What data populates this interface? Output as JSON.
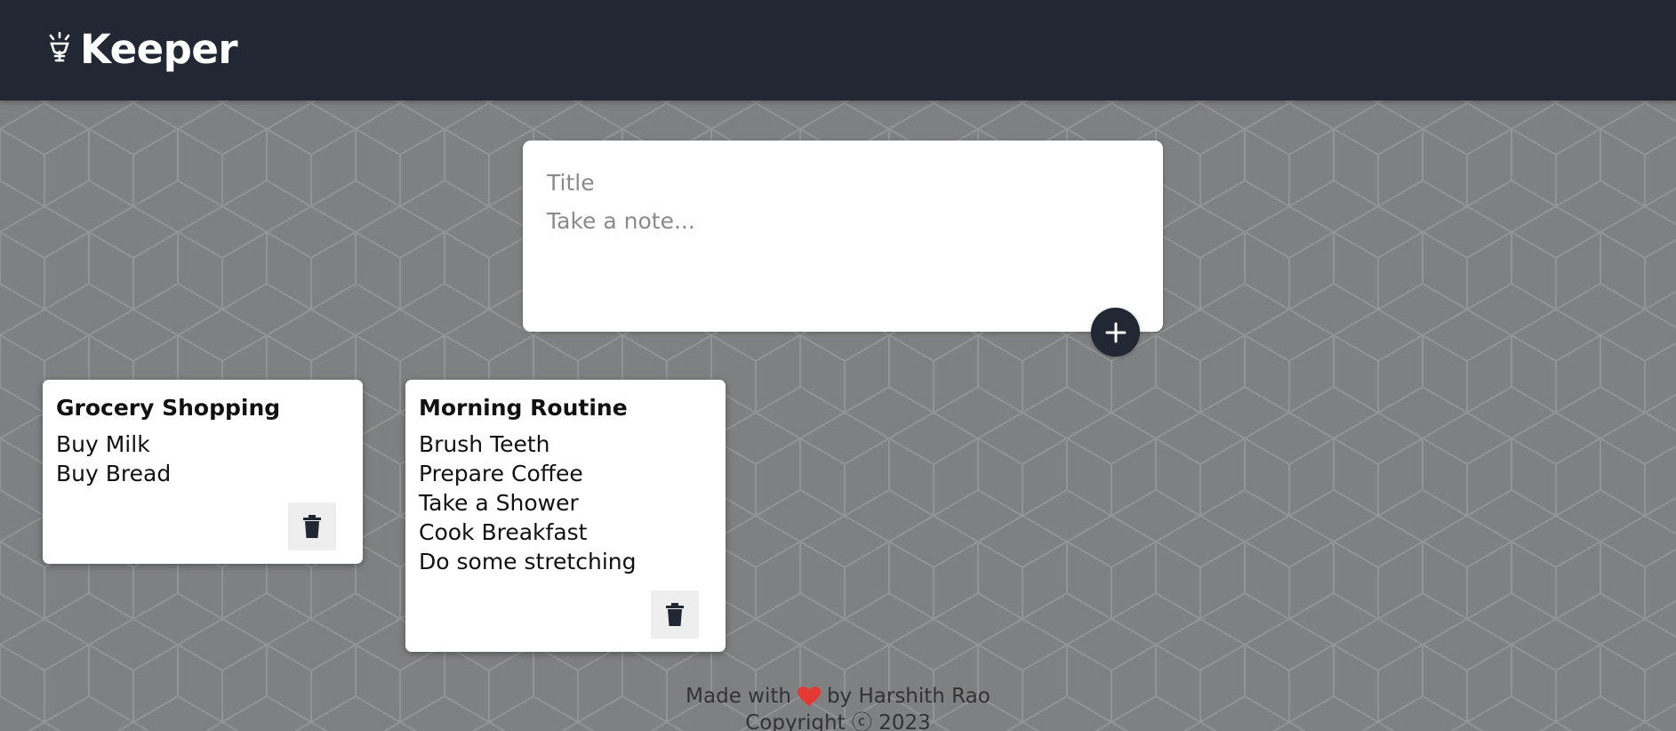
{
  "header": {
    "app_name": "Keeper",
    "logo_icon": "lightbulb-icon",
    "background": "#222833"
  },
  "composer": {
    "title_placeholder": "Title",
    "content_placeholder": "Take a note...",
    "add_button_icon": "plus-icon"
  },
  "notes": [
    {
      "title": "Grocery Shopping",
      "lines": [
        "Buy Milk",
        "Buy Bread"
      ]
    },
    {
      "title": "Morning Routine",
      "lines": [
        "Brush Teeth",
        "Prepare Coffee",
        "Take a Shower",
        "Cook Breakfast",
        "Do some stretching"
      ]
    }
  ],
  "footer": {
    "made_with": "Made with",
    "heart_icon": "heart-icon",
    "by": "by Harshith Rao",
    "copyright": "Copyright ⓒ 2023"
  },
  "colors": {
    "accent": "#222833",
    "heart": "#e53935",
    "background": "#7f8081"
  }
}
